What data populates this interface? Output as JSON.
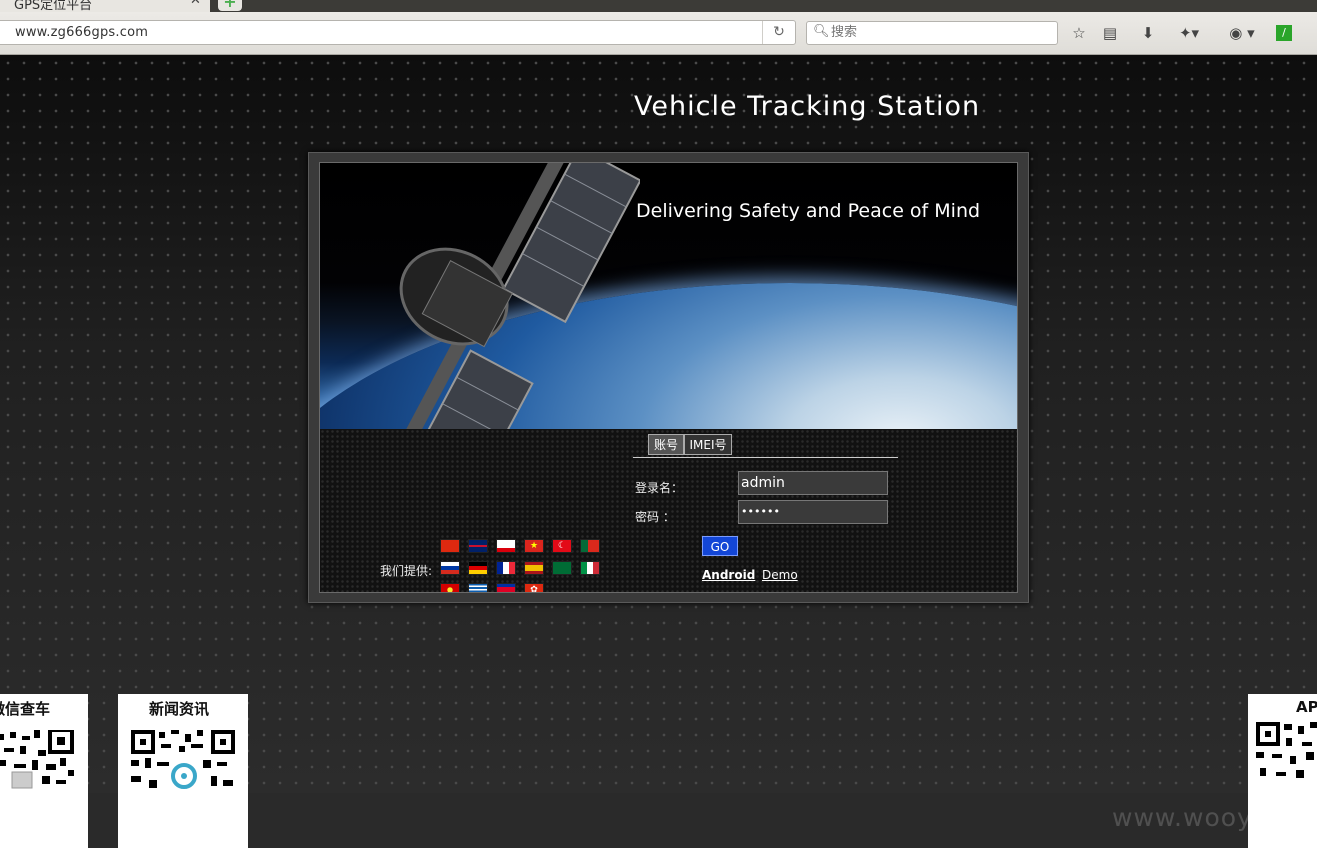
{
  "browser": {
    "tab_title": "GPS定位平台",
    "url": "www.zg666gps.com",
    "search_placeholder": "搜索"
  },
  "header": {
    "title": "Vehicle Tracking Station",
    "tagline": "Delivering Safety and Peace of Mind"
  },
  "login": {
    "tabs": [
      "账号",
      "IMEI号"
    ],
    "username_label": "登录名：",
    "password_label": "密码 ：",
    "username_value": "admin",
    "password_value": "••••••",
    "go_label": "GO",
    "android_link": "Android",
    "demo_link": "Demo"
  },
  "languages": {
    "label": "我们提供:",
    "flags": [
      "china",
      "united-kingdom",
      "gibraltar",
      "vietnam",
      "turkey",
      "portugal",
      "russia",
      "germany",
      "france",
      "spain",
      "saudi-arabia",
      "italy",
      "macedonia",
      "greece",
      "cambodia",
      "hong-kong"
    ]
  },
  "qr_cards": {
    "wechat": "微信查车",
    "news": "新闻资讯",
    "app": "AP"
  },
  "watermark": "www.wooyun.org"
}
